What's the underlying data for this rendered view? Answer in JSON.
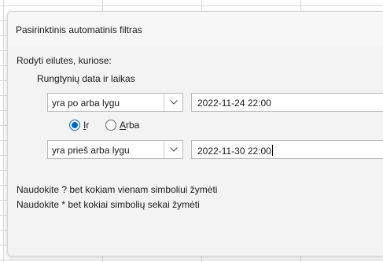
{
  "dialog": {
    "title": "Pasirinktinis automatinis filtras",
    "show_rows_label": "Rodyti eilutes, kuriose:",
    "field_name": "Rungtynių data ir laikas",
    "condition1": {
      "operator": "yra po arba lygu",
      "value": "2022-11-24 22:00"
    },
    "logic": {
      "and_accel": "I",
      "and_rest": "r",
      "or_accel": "A",
      "or_rest": "rba",
      "selected": "Ir"
    },
    "condition2": {
      "operator": "yra prieš arba lygu",
      "value": "2022-11-30 22:00"
    },
    "hint1": "Naudokite ? bet kokiam vienam simboliui žymėti",
    "hint2": "Naudokite * bet kokiai simbolių sekai žymėti"
  },
  "colors": {
    "accent": "#0067c0",
    "dialog_bg": "#f3f3f3",
    "grid_line": "#d9d9d9"
  }
}
